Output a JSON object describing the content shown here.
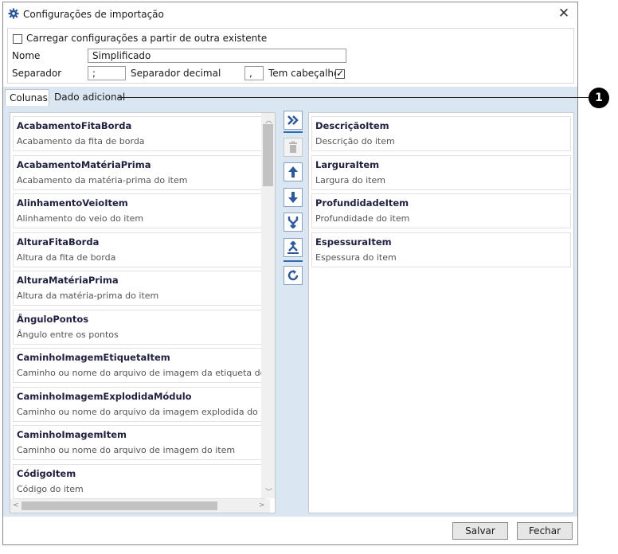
{
  "window": {
    "title": "Configurações de importação",
    "close_glyph": "✕"
  },
  "form": {
    "load_checkbox_label": "Carregar configurações a partir de outra existente",
    "load_checked": false,
    "name_label": "Nome",
    "name_value": "Simplificado",
    "separator_label": "Separador",
    "separator_value": ";",
    "decimal_label": "Separador decimal",
    "decimal_value": ",",
    "header_label": "Tem cabeçalho",
    "header_checked": true
  },
  "tabs": [
    {
      "label": "Colunas",
      "active": true
    },
    {
      "label": "Dado adicional",
      "active": false
    }
  ],
  "available_columns": [
    {
      "name": "AcabamentoFitaBorda",
      "desc": "Acabamento da fita de borda"
    },
    {
      "name": "AcabamentoMatériaPrima",
      "desc": "Acabamento da matéria-prima do item"
    },
    {
      "name": "AlinhamentoVeioItem",
      "desc": "Alinhamento do veio do item"
    },
    {
      "name": "AlturaFitaBorda",
      "desc": "Altura da fita de borda"
    },
    {
      "name": "AlturaMatériaPrima",
      "desc": "Altura da matéria-prima do item"
    },
    {
      "name": "ÂnguloPontos",
      "desc": "Ângulo entre os pontos"
    },
    {
      "name": "CaminhoImagemEtiquetaItem",
      "desc": "Caminho ou nome do arquivo de imagem da etiqueta do ite"
    },
    {
      "name": "CaminhoImagemExplodidaMódulo",
      "desc": "Caminho ou nome do arquivo da imagem explodida do móc"
    },
    {
      "name": "CaminhoImagemItem",
      "desc": "Caminho ou nome do arquivo de imagem do item"
    },
    {
      "name": "CódigoItem",
      "desc": "Código do item"
    }
  ],
  "selected_columns": [
    {
      "name": "DescriçãoItem",
      "desc": "Descrição do item"
    },
    {
      "name": "LarguraItem",
      "desc": "Largura do item"
    },
    {
      "name": "ProfundidadeItem",
      "desc": "Profundidade do item"
    },
    {
      "name": "EspessuraItem",
      "desc": "Espessura do item"
    }
  ],
  "toolbar": {
    "icons": [
      "add-all-icon",
      "delete-icon",
      "move-up-icon",
      "move-down-icon",
      "merge-icon",
      "split-icon",
      "refresh-icon"
    ]
  },
  "buttons": {
    "save": "Salvar",
    "close": "Fechar"
  },
  "callout": {
    "number": "1"
  },
  "colors": {
    "accent": "#2e6ab0",
    "panel_bg": "#dbe6f3"
  }
}
